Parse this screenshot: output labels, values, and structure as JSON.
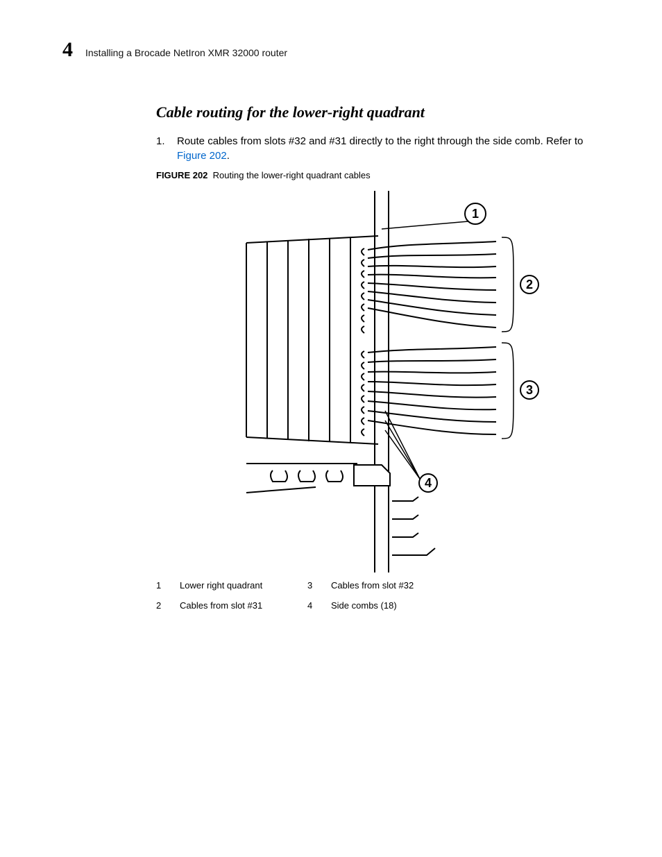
{
  "header": {
    "chapter_number": "4",
    "running_title": "Installing a Brocade NetIron XMR 32000 router"
  },
  "section": {
    "heading": "Cable routing for the lower-right quadrant",
    "step": {
      "num": "1.",
      "text_before_link": "Route cables from slots #32 and #31 directly to the right through the side comb. Refer to ",
      "link_text": "Figure 202",
      "text_after_link": "."
    }
  },
  "figure": {
    "label": "FIGURE 202",
    "caption": "Routing the lower-right quadrant cables",
    "callouts": [
      "1",
      "2",
      "3",
      "4"
    ],
    "legend": [
      {
        "n": "1",
        "t": "Lower right quadrant"
      },
      {
        "n": "2",
        "t": "Cables from slot #31"
      },
      {
        "n": "3",
        "t": "Cables from slot #32"
      },
      {
        "n": "4",
        "t": "Side combs (18)"
      }
    ]
  }
}
